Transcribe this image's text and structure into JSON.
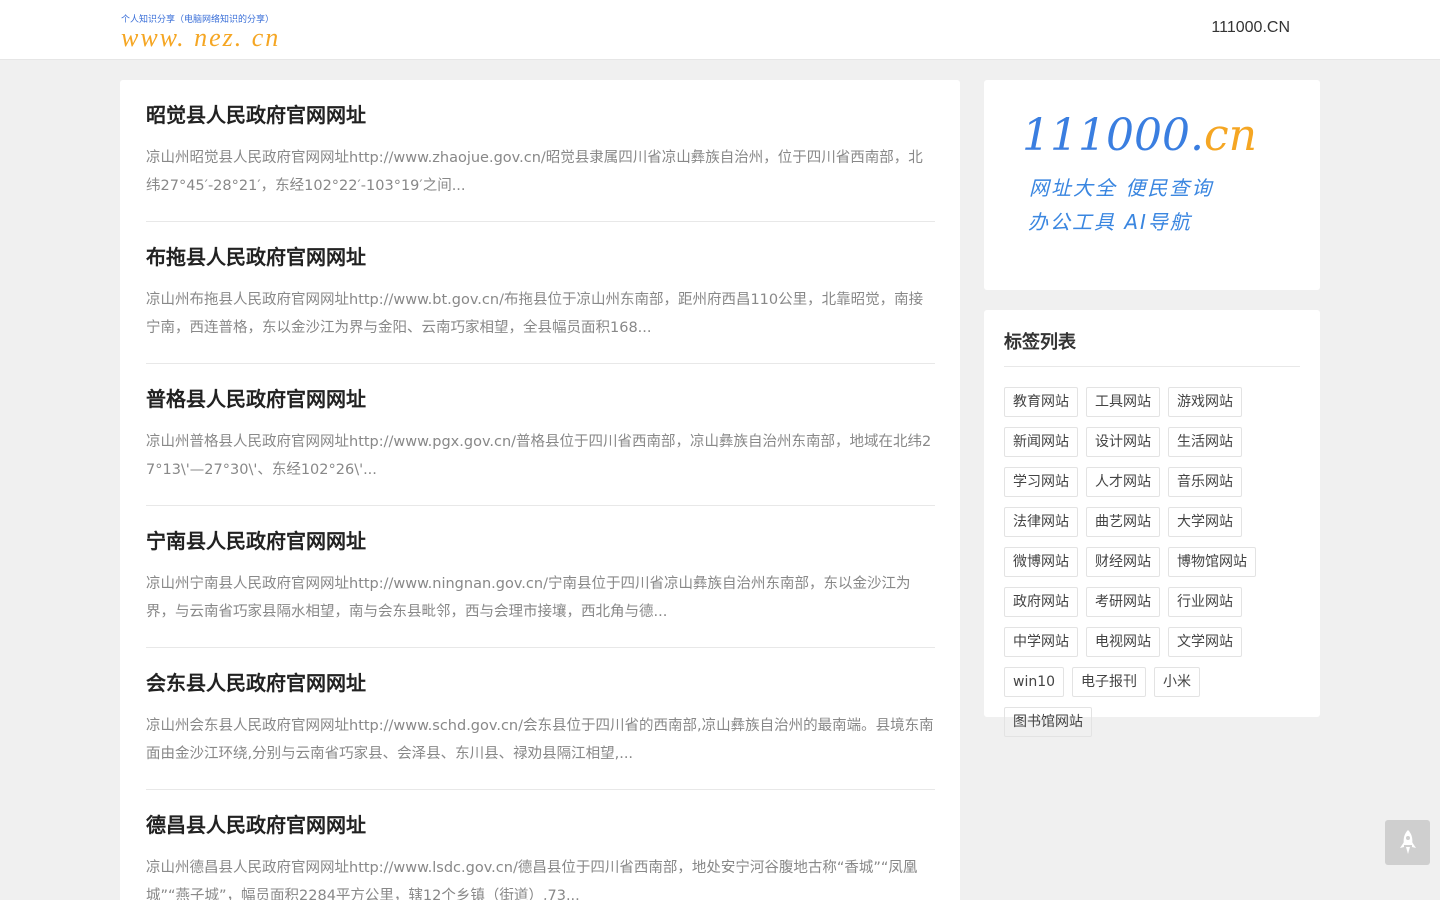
{
  "header": {
    "logo_tagline": "个人知识分享（电脑网络知识的分享）",
    "logo_text": "www. nez. cn",
    "top_link": "111000.CN"
  },
  "posts": [
    {
      "title": "昭觉县人民政府官网网址",
      "excerpt": "凉山州昭觉县人民政府官网网址http://www.zhaojue.gov.cn/昭觉县隶属四川省凉山彝族自治州，位于四川省西南部，北纬27°45′-28°21′，东经102°22′-103°19′之间..."
    },
    {
      "title": "布拖县人民政府官网网址",
      "excerpt": "凉山州布拖县人民政府官网网址http://www.bt.gov.cn/布拖县位于凉山州东南部，距州府西昌110公里，北靠昭觉，南接宁南，西连普格，东以金沙江为界与金阳、云南巧家相望，全县幅员面积168..."
    },
    {
      "title": "普格县人民政府官网网址",
      "excerpt": "凉山州普格县人民政府官网网址http://www.pgx.gov.cn/普格县位于四川省西南部，凉山彝族自治州东南部，地域在北纬27°13\\'—27°30\\'、东经102°26\\'..."
    },
    {
      "title": "宁南县人民政府官网网址",
      "excerpt": "凉山州宁南县人民政府官网网址http://www.ningnan.gov.cn/宁南县位于四川省凉山彝族自治州东南部，东以金沙江为界，与云南省巧家县隔水相望，南与会东县毗邻，西与会理市接壤，西北角与德..."
    },
    {
      "title": "会东县人民政府官网网址",
      "excerpt": "凉山州会东县人民政府官网网址http://www.schd.gov.cn/会东县位于四川省的西南部,凉山彝族自治州的最南端。县境东南面由金沙江环绕,分别与云南省巧家县、会泽县、东川县、禄劝县隔江相望,..."
    },
    {
      "title": "德昌县人民政府官网网址",
      "excerpt": "凉山州德昌县人民政府官网网址http://www.lsdc.gov.cn/德昌县位于四川省西南部，地处安宁河谷腹地古称“香城”“凤凰城”“燕子城”，幅员面积2284平方公里，辖12个乡镇（街道）,73..."
    }
  ],
  "banner": {
    "brand_main": "111000.",
    "brand_suffix": "cn",
    "line1": "网址大全 便民查询",
    "line2": "办公工具 AI导航"
  },
  "tags": {
    "title": "标签列表",
    "items": [
      "教育网站",
      "工具网站",
      "游戏网站",
      "新闻网站",
      "设计网站",
      "生活网站",
      "学习网站",
      "人才网站",
      "音乐网站",
      "法律网站",
      "曲艺网站",
      "大学网站",
      "微博网站",
      "财经网站",
      "博物馆网站",
      "政府网站",
      "考研网站",
      "行业网站",
      "中学网站",
      "电视网站",
      "文学网站",
      "win10",
      "电子报刊",
      "小米",
      "图书馆网站"
    ]
  },
  "icons": {
    "back_to_top": "rocket-icon"
  },
  "colors": {
    "logo_orange": "#f5a623",
    "brand_blue": "#3a7ee0"
  }
}
